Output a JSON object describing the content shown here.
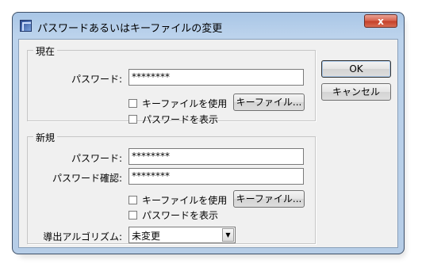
{
  "window": {
    "title": "パスワードあるいはキーファイルの変更",
    "close_symbol": "x"
  },
  "current": {
    "legend": "現在",
    "password_label": "パスワード:",
    "password_value": "********",
    "use_keyfile_label": "キーファイルを使用",
    "use_keyfile_checked": false,
    "show_password_label": "パスワードを表示",
    "show_password_checked": false,
    "keyfile_button": "キーファイル..."
  },
  "new": {
    "legend": "新規",
    "password_label": "パスワード:",
    "password_value": "********",
    "confirm_label": "パスワード確認:",
    "confirm_value": "********",
    "use_keyfile_label": "キーファイルを使用",
    "use_keyfile_checked": false,
    "show_password_label": "パスワードを表示",
    "show_password_checked": false,
    "keyfile_button": "キーファイル...",
    "algorithm_label": "導出アルゴリズム:",
    "algorithm_value": "未変更"
  },
  "buttons": {
    "ok": "OK",
    "cancel": "キャンセル"
  },
  "icons": {
    "app": "app-icon",
    "close": "close-icon",
    "dropdown": "chevron-down-icon"
  }
}
